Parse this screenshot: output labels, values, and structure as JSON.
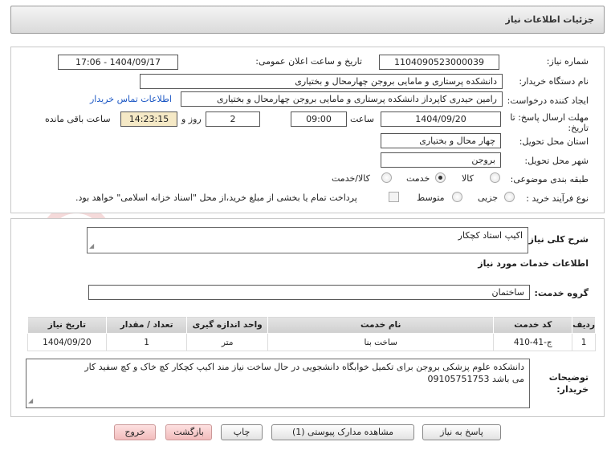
{
  "page": {
    "title": "جزئیات اطلاعات نیاز"
  },
  "form": {
    "need_number_label": "شماره نیاز:",
    "need_number": "1104090523000039",
    "announce_label": "تاریخ و ساعت اعلان عمومی:",
    "announce_value": "1404/09/17 - 17:06",
    "buyer_org_label": "نام دستگاه خریدار:",
    "buyer_org": "دانشکده پرستاری و مامایی بروجن چهارمحال و بختیاری",
    "requester_label": "ایجاد کننده درخواست:",
    "requester": "رامین حیدری کاپرداز دانشکده پرستاری و مامایی بروجن چهارمحال و بختیاری",
    "contact_link": "اطلاعات تماس خریدار",
    "deadline_label_1": "مهلت ارسال پاسخ: تا",
    "deadline_label_2": "تاریخ:",
    "deadline_date": "1404/09/20",
    "time_label": "ساعت",
    "deadline_time": "09:00",
    "days_value": "2",
    "days_label": "روز و",
    "remaining_time": "14:23:15",
    "remaining_label": "ساعت باقی مانده",
    "province_label": "استان محل تحویل:",
    "province": "چهار محال و بختیاری",
    "city_label": "شهر محل تحویل:",
    "city": "بروجن",
    "category_label": "طبقه بندی موضوعی:",
    "category_options": [
      "کالا",
      "خدمت",
      "کالا/خدمت"
    ],
    "category_selected": "خدمت",
    "process_label": "نوع فرآیند خرید :",
    "process_options": [
      "جزیی",
      "متوسط"
    ],
    "process_selected": "",
    "payment_note": "پرداخت تمام یا بخشی از مبلغ خرید،از محل \"اسناد خزانه اسلامی\" خواهد بود."
  },
  "summary": {
    "label": "شرح کلی نیاز:",
    "value": "اکیپ استاد کچکار"
  },
  "services": {
    "section_title": "اطلاعات خدمات مورد نیاز",
    "group_label": "گروه خدمت:",
    "group_value": "ساختمان",
    "headers": [
      "ردیف",
      "کد خدمت",
      "نام خدمت",
      "واحد اندازه گیری",
      "تعداد / مقدار",
      "تاریخ نیاز"
    ],
    "rows": [
      [
        "1",
        "ج-41-410",
        "ساخت بنا",
        "متر",
        "1",
        "1404/09/20"
      ]
    ]
  },
  "buyer_notes": {
    "label_1": "توضیحات",
    "label_2": "خریدار:",
    "text_1": "دانشکده علوم پزشکی بروجن برای تکمیل خوابگاه دانشجویی در حال ساخت نیاز مند اکیپ کچکار  کچ خاک و کچ سفید کار",
    "text_2": "می باشد 09105751753"
  },
  "buttons": {
    "reply": "پاسخ به نیاز",
    "attachments": "مشاهده مدارک پیوستی (1)",
    "print": "چاپ",
    "back": "بازگشت",
    "exit": "خروج"
  },
  "colors": {
    "link": "#1a56c4",
    "watermark": "#c81e1e",
    "header_bg": "#d8d8d8"
  }
}
